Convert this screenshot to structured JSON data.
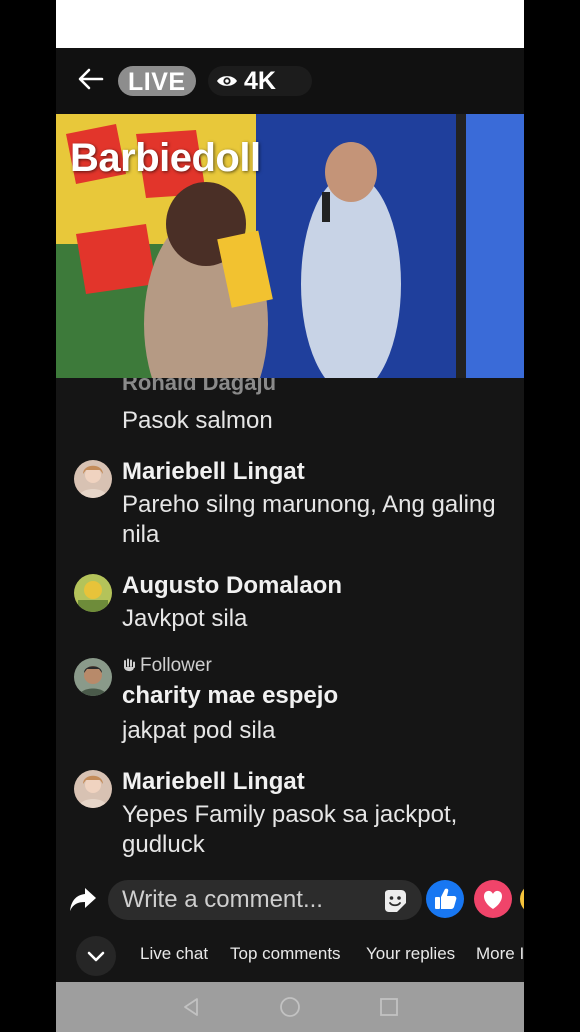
{
  "header": {
    "live_label": "LIVE",
    "viewer_count": "4K"
  },
  "video": {
    "overlay_title": "Barbiedoll"
  },
  "comments": [
    {
      "name": "Ronald Dagaju",
      "text": "Pasok salmon"
    },
    {
      "name": "Mariebell Lingat",
      "text": "Pareho silng marunong, Ang galing nila"
    },
    {
      "name": "Augusto Domalaon",
      "text": "Javkpot sila"
    },
    {
      "tag": "Follower",
      "name": "charity mae espejo",
      "text": "jakpat pod sila"
    },
    {
      "name": "Mariebell Lingat",
      "text": "Yepes Family pasok sa jackpot, gudluck"
    }
  ],
  "composer": {
    "placeholder": "Write a comment..."
  },
  "tabs": [
    {
      "label": "Live chat"
    },
    {
      "label": "Top comments"
    },
    {
      "label": "Your replies"
    },
    {
      "label": "More I"
    }
  ],
  "colors": {
    "like_blue": "#1877f2",
    "love_pink": "#f0446a",
    "background": "#151515"
  }
}
